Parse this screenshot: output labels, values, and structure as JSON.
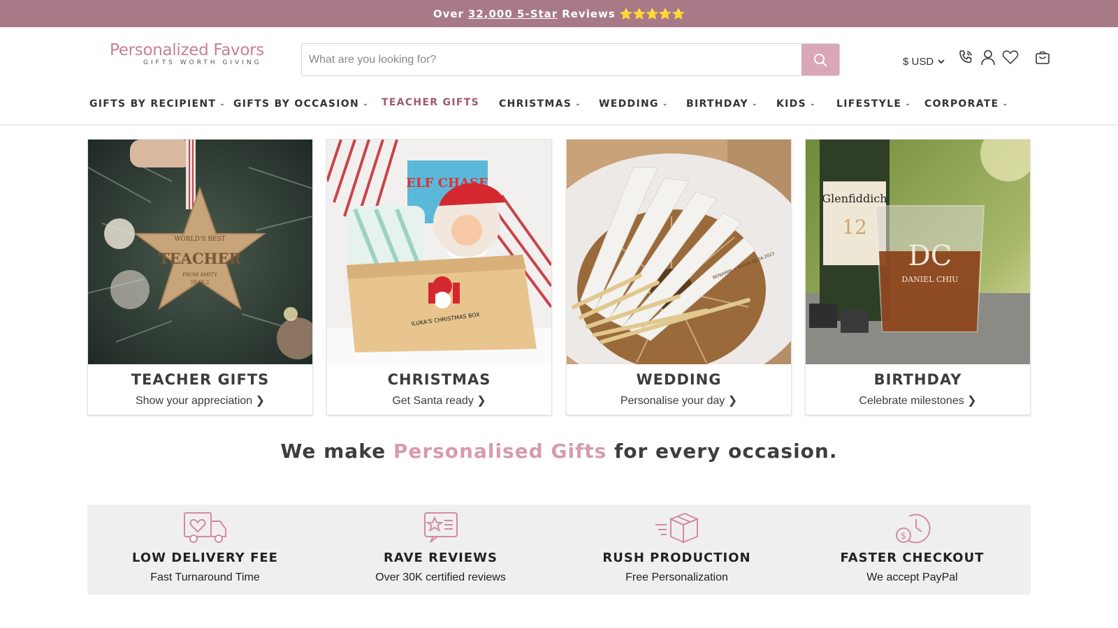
{
  "announcement": {
    "prefix": "Over",
    "link": "32,000 5-Star",
    "suffix": "Reviews",
    "stars": "⭐⭐⭐⭐⭐"
  },
  "brand": {
    "name": "Personalized Favors",
    "tagline": "GIFTS WORTH GIVING"
  },
  "search": {
    "placeholder": "What are you looking for?",
    "value": ""
  },
  "currency": {
    "label": "$ USD"
  },
  "header_icons": [
    "phone-icon",
    "account-icon",
    "wishlist-heart-icon",
    "cart-bag-icon"
  ],
  "nav": {
    "items": [
      {
        "label": "GIFTS BY RECIPIENT",
        "dropdown": true
      },
      {
        "label": "GIFTS BY OCCASION",
        "dropdown": true
      },
      {
        "label": "TEACHER GIFTS",
        "dropdown": false
      },
      {
        "label": "CHRISTMAS",
        "dropdown": true
      },
      {
        "label": "WEDDING",
        "dropdown": true
      },
      {
        "label": "BIRTHDAY",
        "dropdown": true
      },
      {
        "label": "KIDS",
        "dropdown": true
      },
      {
        "label": "LIFESTYLE",
        "dropdown": true
      },
      {
        "label": "CORPORATE",
        "dropdown": true
      }
    ]
  },
  "cards": [
    {
      "title": "TEACHER GIFTS",
      "subtitle": "Show your appreciation ❯",
      "image_text": [
        "WORLD'S BEST",
        "TEACHER",
        "FROM AMITY",
        "YEAR 2"
      ]
    },
    {
      "title": "CHRISTMAS",
      "subtitle": "Get Santa ready ❯",
      "image_text": [
        "ELF CHASE",
        "ILUKA'S CHRISTMAS BOX"
      ]
    },
    {
      "title": "WEDDING",
      "subtitle": "Personalise your day ❯",
      "image_text": [
        "BENJAMIN + OLIVIA 08.04.2023"
      ]
    },
    {
      "title": "BIRTHDAY",
      "subtitle": "Celebrate milestones ❯",
      "image_text": [
        "Glenfiddich",
        "12",
        "DC",
        "DANIEL CHIU"
      ]
    }
  ],
  "tagline": {
    "before": "We make",
    "highlight": "Personalised Gifts",
    "after": "for every occasion."
  },
  "features": [
    {
      "icon": "delivery-truck-heart-icon",
      "title": "LOW DELIVERY FEE",
      "subtitle": "Fast Turnaround Time"
    },
    {
      "icon": "review-star-card-icon",
      "title": "RAVE REVIEWS",
      "subtitle": "Over 30K certified reviews"
    },
    {
      "icon": "fast-box-icon",
      "title": "RUSH PRODUCTION",
      "subtitle": "Free Personalization"
    },
    {
      "icon": "clock-dollar-icon",
      "title": "FASTER CHECKOUT",
      "subtitle": "We accept PayPal"
    }
  ],
  "colors": {
    "announcement_bg": "#a87a88",
    "brand_pink": "#c87e94",
    "search_button": "#d9a7b5",
    "nav_accent": "#a0586f",
    "highlight_pink": "#d69bb0",
    "features_bg": "#efefef",
    "icon_pink": "#d48aa0"
  }
}
